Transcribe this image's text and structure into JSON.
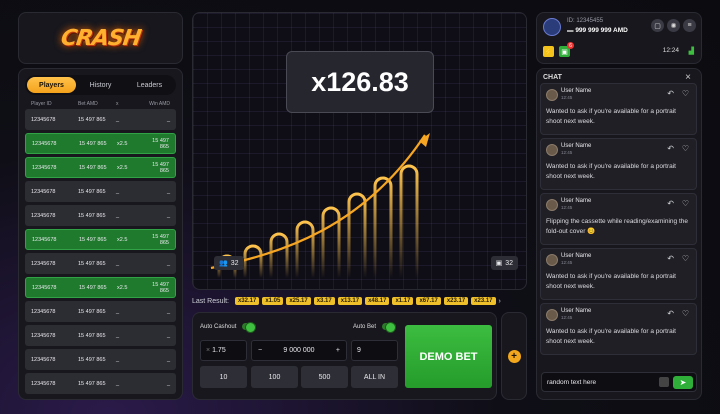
{
  "logo": {
    "text": "CRASH"
  },
  "tabs": [
    {
      "label": "Players",
      "active": true
    },
    {
      "label": "History",
      "active": false
    },
    {
      "label": "Leaders",
      "active": false
    }
  ],
  "table": {
    "headers": [
      "Player ID",
      "Bet AMD",
      "x",
      "Win AMD"
    ],
    "rows": [
      {
        "id": "12345678",
        "bet": "15 497 865",
        "x": "_",
        "win": "_",
        "won": false
      },
      {
        "id": "12345678",
        "bet": "15 497 865",
        "x": "x2.5",
        "win": "15 497 865",
        "won": true
      },
      {
        "id": "12345678",
        "bet": "15 497 865",
        "x": "x2.5",
        "win": "15 497 865",
        "won": true
      },
      {
        "id": "12345678",
        "bet": "15 497 865",
        "x": "_",
        "win": "_",
        "won": false
      },
      {
        "id": "12345678",
        "bet": "15 497 865",
        "x": "_",
        "win": "_",
        "won": false
      },
      {
        "id": "12345678",
        "bet": "15 497 865",
        "x": "x2.5",
        "win": "15 497 865",
        "won": true
      },
      {
        "id": "12345678",
        "bet": "15 497 865",
        "x": "_",
        "win": "_",
        "won": false
      },
      {
        "id": "12345678",
        "bet": "15 497 865",
        "x": "x2.5",
        "win": "15 497 865",
        "won": true
      },
      {
        "id": "12345678",
        "bet": "15 497 865",
        "x": "_",
        "win": "_",
        "won": false
      },
      {
        "id": "12345678",
        "bet": "15 497 865",
        "x": "_",
        "win": "_",
        "won": false
      },
      {
        "id": "12345678",
        "bet": "15 497 865",
        "x": "_",
        "win": "_",
        "won": false
      },
      {
        "id": "12345678",
        "bet": "15 497 865",
        "x": "_",
        "win": "_",
        "won": false
      }
    ]
  },
  "graph": {
    "multiplier": "x126.83",
    "players_left": "32",
    "players_right": "32"
  },
  "last_result": {
    "label": "Last Result:",
    "values": [
      "x32.17",
      "x1.05",
      "x25.17",
      "x3.17",
      "x13.17",
      "x48.17",
      "x1.17",
      "x67.17",
      "x23.17",
      "x23.17"
    ]
  },
  "bet": {
    "auto_cashout_label": "Auto Cashout",
    "auto_bet_label": "Auto Bet",
    "cashout_value": "1.75",
    "amount_value": "9 000 000",
    "auto_bet_count": "9",
    "minus": "−",
    "plus": "+",
    "quick": [
      "10",
      "100",
      "500",
      "ALL IN"
    ],
    "demo_bet_label": "DEMO BET",
    "add_bet": "+"
  },
  "user": {
    "id": "ID: 12345455",
    "balance": "999 999 999 AMD",
    "time": "12:24",
    "notif_badge": "6"
  },
  "chat": {
    "title": "CHAT",
    "messages": [
      {
        "name": "User Name",
        "time": "12:45",
        "text": "Wanted to ask if you're available for a portrait shoot next week."
      },
      {
        "name": "User Name",
        "time": "12:45",
        "text": "Wanted to ask if you're available for a portrait shoot next week."
      },
      {
        "name": "User Name",
        "time": "12:45",
        "text": "Flipping the cassette while reading/examining the fold-out cover 😊"
      },
      {
        "name": "User Name",
        "time": "12:45",
        "text": "Wanted to ask if you're available for a portrait shoot next week."
      },
      {
        "name": "User Name",
        "time": "12:45",
        "text": "Wanted to ask if you're available for a portrait shoot next week."
      }
    ],
    "input_value": "random text here"
  },
  "colors": {
    "accent": "#f4a21c",
    "win_row": "#1f7a2e",
    "bet_button": "#2fa836",
    "chip": "#f0c02a"
  }
}
